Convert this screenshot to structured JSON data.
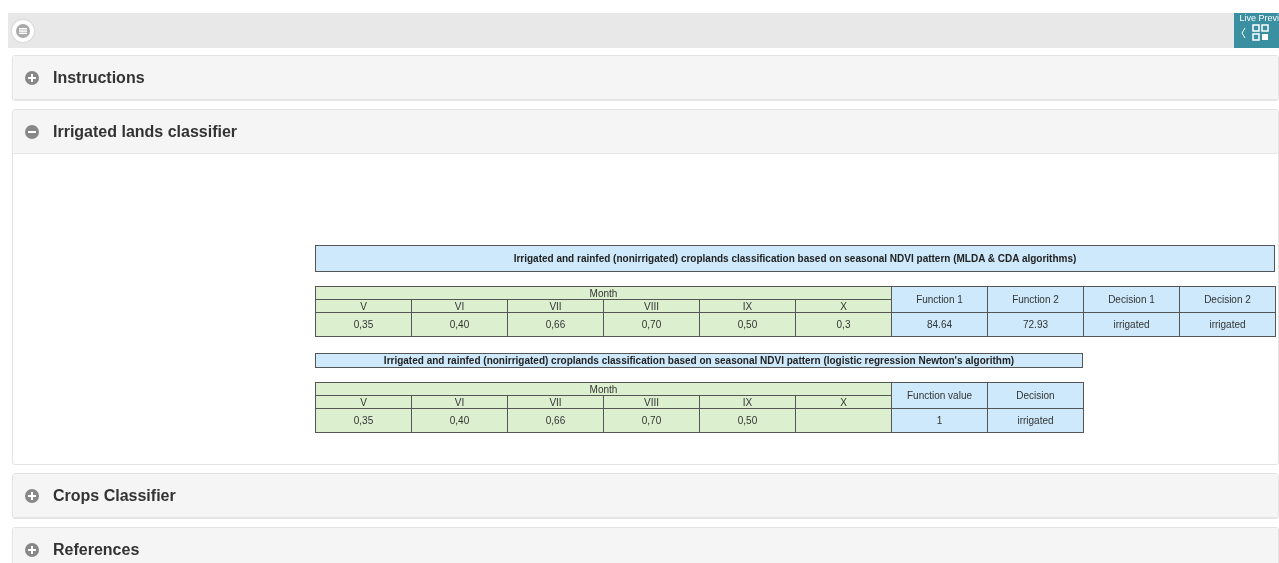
{
  "top_bar": {
    "preview_widget": {
      "label": "Live Previ"
    }
  },
  "sections": [
    {
      "title": "Instructions",
      "expanded": false
    },
    {
      "title": "Irrigated lands classifier",
      "expanded": true,
      "tables": [
        {
          "title": "Irrigated and rainfed (nonirrigated) croplands classification based on seasonal NDVI pattern (MLDA & CDA algorithms)",
          "group_label": "Month",
          "months": [
            "V",
            "VI",
            "VII",
            "VIII",
            "IX",
            "X"
          ],
          "month_values": [
            "0,35",
            "0,40",
            "0,66",
            "0,70",
            "0,50",
            "0,3"
          ],
          "result_columns": [
            "Function 1",
            "Function 2",
            "Decision 1",
            "Decision 2"
          ],
          "results": [
            "84.64",
            "72.93",
            "irrigated",
            "irrigated"
          ]
        },
        {
          "title": "Irrigated and rainfed (nonirrigated) croplands classification based on seasonal NDVI pattern (logistic regression Newton's algorithm)",
          "group_label": "Month",
          "months": [
            "V",
            "VI",
            "VII",
            "VIII",
            "IX",
            "X"
          ],
          "month_values": [
            "0,35",
            "0,40",
            "0,66",
            "0,70",
            "0,50"
          ],
          "result_columns": [
            "Function value",
            "Decision"
          ],
          "results": [
            "1",
            "irrigated"
          ]
        }
      ]
    },
    {
      "title": "Crops Classifier",
      "expanded": false
    },
    {
      "title": "References",
      "expanded": false
    }
  ]
}
